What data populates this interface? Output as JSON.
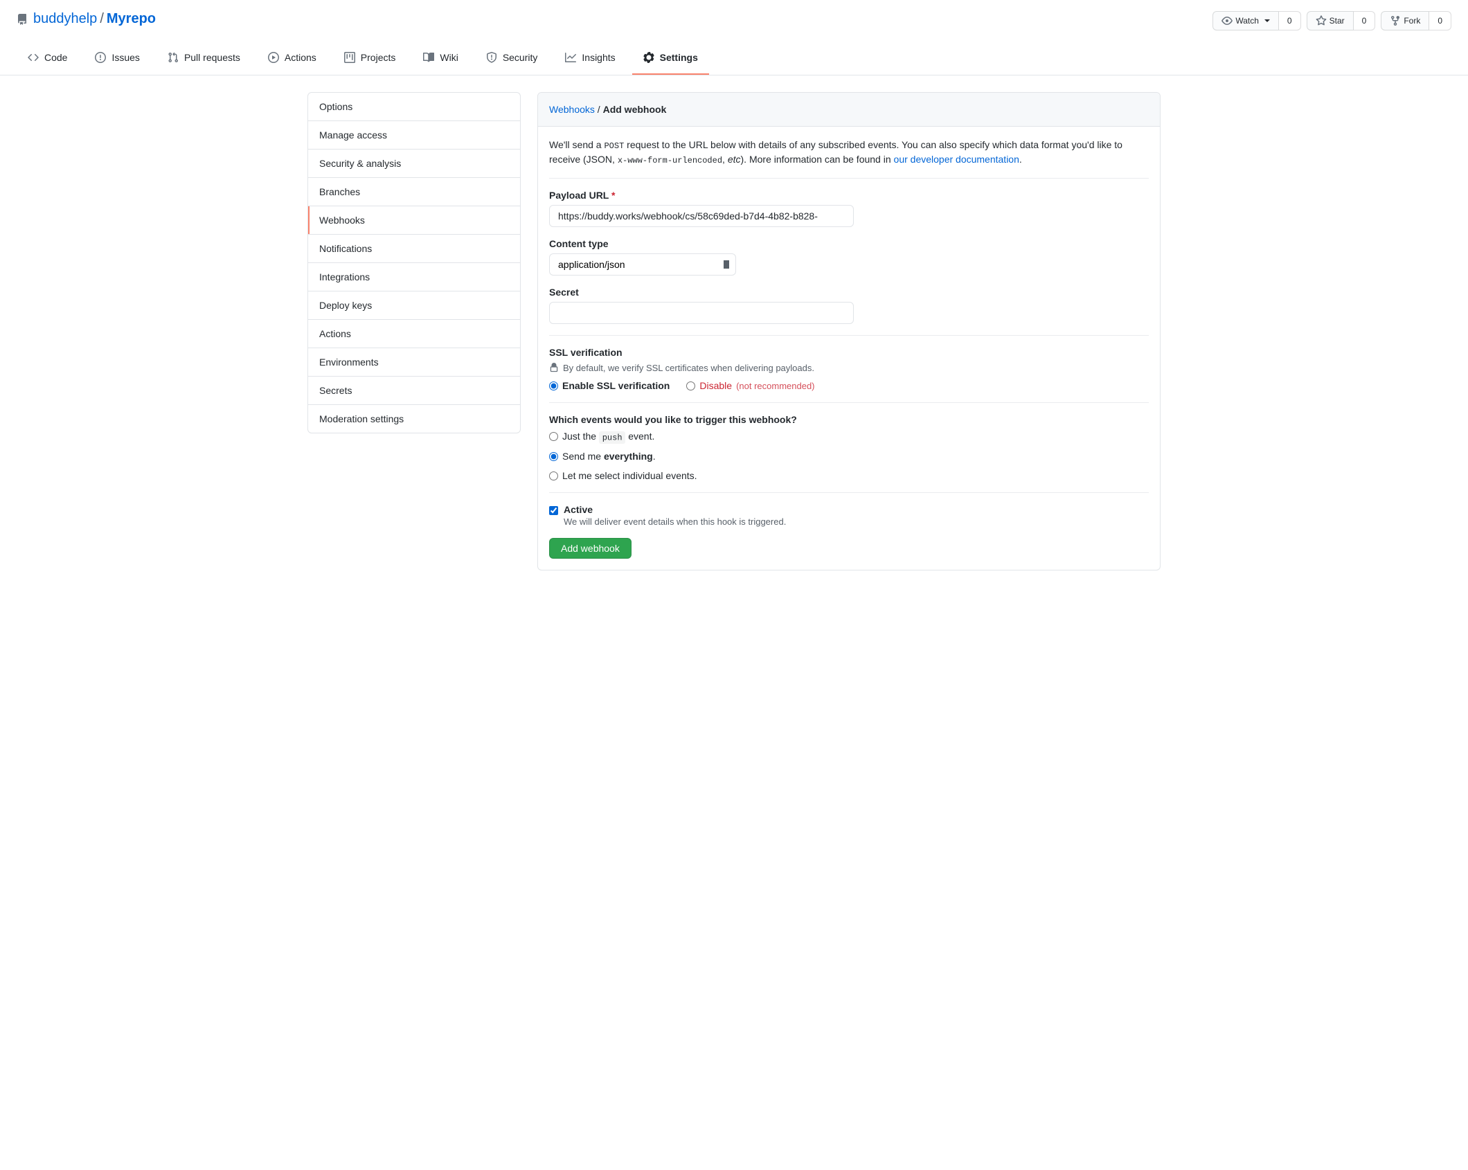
{
  "repo": {
    "owner": "buddyhelp",
    "name": "Myrepo",
    "sep": "/"
  },
  "actions": {
    "watch": {
      "label": "Watch",
      "count": "0"
    },
    "star": {
      "label": "Star",
      "count": "0"
    },
    "fork": {
      "label": "Fork",
      "count": "0"
    }
  },
  "nav": {
    "code": "Code",
    "issues": "Issues",
    "pulls": "Pull requests",
    "actions": "Actions",
    "projects": "Projects",
    "wiki": "Wiki",
    "security": "Security",
    "insights": "Insights",
    "settings": "Settings"
  },
  "sidebar": {
    "items": [
      "Options",
      "Manage access",
      "Security & analysis",
      "Branches",
      "Webhooks",
      "Notifications",
      "Integrations",
      "Deploy keys",
      "Actions",
      "Environments",
      "Secrets",
      "Moderation settings"
    ]
  },
  "breadcrumb": {
    "root": "Webhooks",
    "sep": " / ",
    "current": "Add webhook"
  },
  "intro": {
    "part1": "We'll send a ",
    "code1": "POST",
    "part2": " request to the URL below with details of any subscribed events. You can also specify which data format you'd like to receive (JSON, ",
    "code2": "x-www-form-urlencoded",
    "part3": ", ",
    "em": "etc",
    "part4": "). More information can be found in ",
    "link": "our developer documentation",
    "part5": "."
  },
  "form": {
    "payload_label": "Payload URL",
    "payload_value": "https://buddy.works/webhook/cs/58c69ded-b7d4-4b82-b828-",
    "content_type_label": "Content type",
    "content_type_value": "application/json",
    "secret_label": "Secret",
    "secret_value": ""
  },
  "ssl": {
    "heading": "SSL verification",
    "note": "By default, we verify SSL certificates when delivering payloads.",
    "enable": "Enable SSL verification",
    "disable": "Disable",
    "disable_note": "(not recommended)"
  },
  "events": {
    "heading": "Which events would you like to trigger this webhook?",
    "push_a": "Just the ",
    "push_code": "push",
    "push_b": " event.",
    "everything_a": "Send me ",
    "everything_b": "everything",
    "everything_c": ".",
    "individual": "Let me select individual events."
  },
  "active": {
    "label": "Active",
    "desc": "We will deliver event details when this hook is triggered."
  },
  "submit": "Add webhook"
}
